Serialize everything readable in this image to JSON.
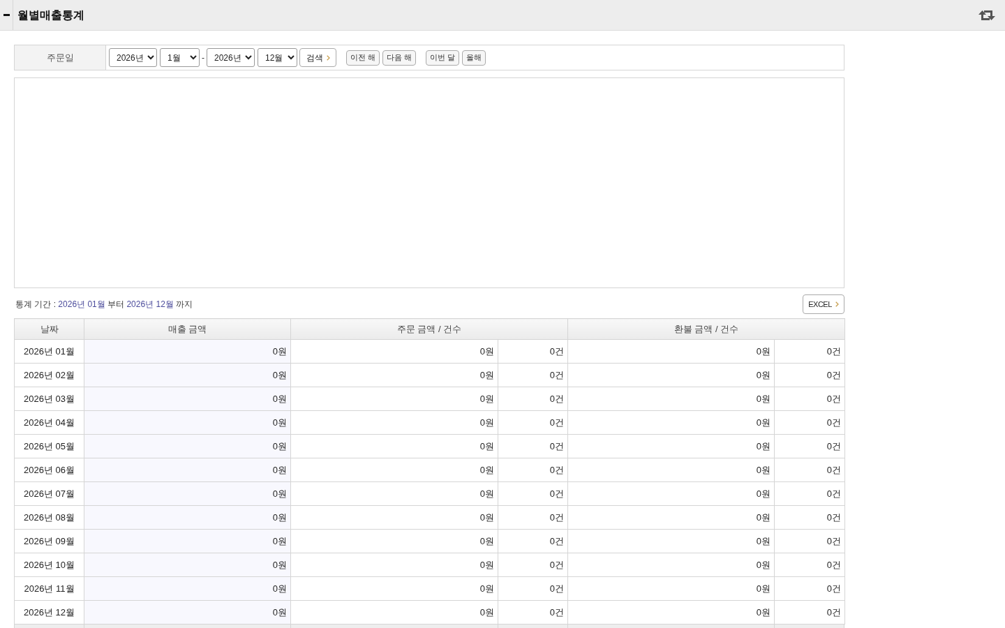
{
  "header": {
    "title": "월별매출통계"
  },
  "search": {
    "label": "주문일",
    "start_year": "2026년",
    "start_month": "1월",
    "separator": "-",
    "end_year": "2026년",
    "end_month": "12월",
    "search_button": "검색",
    "year_buttons": [
      {
        "label": "이전 해"
      },
      {
        "label": "다음 해"
      }
    ],
    "month_buttons": [
      {
        "label": "이번 달"
      },
      {
        "label": "올해"
      }
    ]
  },
  "period": {
    "parts": [
      {
        "text": "통계 기간 :",
        "highlight": false
      },
      {
        "text": "2026년 01월",
        "highlight": true
      },
      {
        "text": "부터",
        "highlight": false
      },
      {
        "text": "2026년 12월",
        "highlight": true
      },
      {
        "text": "까지",
        "highlight": false
      }
    ]
  },
  "excel_button": "EXCEL",
  "table": {
    "columns": [
      {
        "label": "날짜",
        "kind": "single"
      },
      {
        "label": "매출 금액",
        "kind": "single"
      },
      {
        "label": "주문 금액 / 건수",
        "kind": "pair"
      },
      {
        "label": "환불 금액 / 건수",
        "kind": "pair"
      }
    ],
    "rows": [
      {
        "date": "2026년 01월",
        "sales": "0원",
        "order_amount": "0원",
        "order_count": "0건",
        "refund_amount": "0원",
        "refund_count": "0건"
      },
      {
        "date": "2026년 02월",
        "sales": "0원",
        "order_amount": "0원",
        "order_count": "0건",
        "refund_amount": "0원",
        "refund_count": "0건"
      },
      {
        "date": "2026년 03월",
        "sales": "0원",
        "order_amount": "0원",
        "order_count": "0건",
        "refund_amount": "0원",
        "refund_count": "0건"
      },
      {
        "date": "2026년 04월",
        "sales": "0원",
        "order_amount": "0원",
        "order_count": "0건",
        "refund_amount": "0원",
        "refund_count": "0건"
      },
      {
        "date": "2026년 05월",
        "sales": "0원",
        "order_amount": "0원",
        "order_count": "0건",
        "refund_amount": "0원",
        "refund_count": "0건"
      },
      {
        "date": "2026년 06월",
        "sales": "0원",
        "order_amount": "0원",
        "order_count": "0건",
        "refund_amount": "0원",
        "refund_count": "0건"
      },
      {
        "date": "2026년 07월",
        "sales": "0원",
        "order_amount": "0원",
        "order_count": "0건",
        "refund_amount": "0원",
        "refund_count": "0건"
      },
      {
        "date": "2026년 08월",
        "sales": "0원",
        "order_amount": "0원",
        "order_count": "0건",
        "refund_amount": "0원",
        "refund_count": "0건"
      },
      {
        "date": "2026년 09월",
        "sales": "0원",
        "order_amount": "0원",
        "order_count": "0건",
        "refund_amount": "0원",
        "refund_count": "0건"
      },
      {
        "date": "2026년 10월",
        "sales": "0원",
        "order_amount": "0원",
        "order_count": "0건",
        "refund_amount": "0원",
        "refund_count": "0건"
      },
      {
        "date": "2026년 11월",
        "sales": "0원",
        "order_amount": "0원",
        "order_count": "0건",
        "refund_amount": "0원",
        "refund_count": "0건"
      },
      {
        "date": "2026년 12월",
        "sales": "0원",
        "order_amount": "0원",
        "order_count": "0건",
        "refund_amount": "0원",
        "refund_count": "0건"
      }
    ]
  }
}
